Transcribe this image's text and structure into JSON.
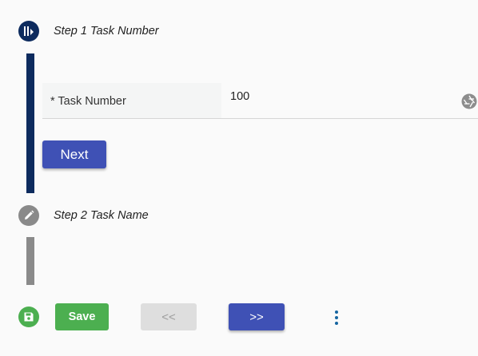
{
  "colors": {
    "primary": "#3f51b5",
    "step_active": "#0d2b5e",
    "step_inactive": "#8a8a8a",
    "save_green": "#4caf50"
  },
  "steps": [
    {
      "title": "Step 1 Task Number",
      "icon": "step-active-icon"
    },
    {
      "title": "Step 2 Task Name",
      "icon": "pencil-icon"
    }
  ],
  "form": {
    "task_number_label": "* Task Number",
    "task_number_value": "100",
    "field_icon": "aperture-icon",
    "next_label": "Next"
  },
  "toolbar": {
    "save_icon": "save-icon",
    "save_label": "Save",
    "prev_label": "<<",
    "next_label": ">>",
    "more_icon": "more-vertical-icon"
  }
}
